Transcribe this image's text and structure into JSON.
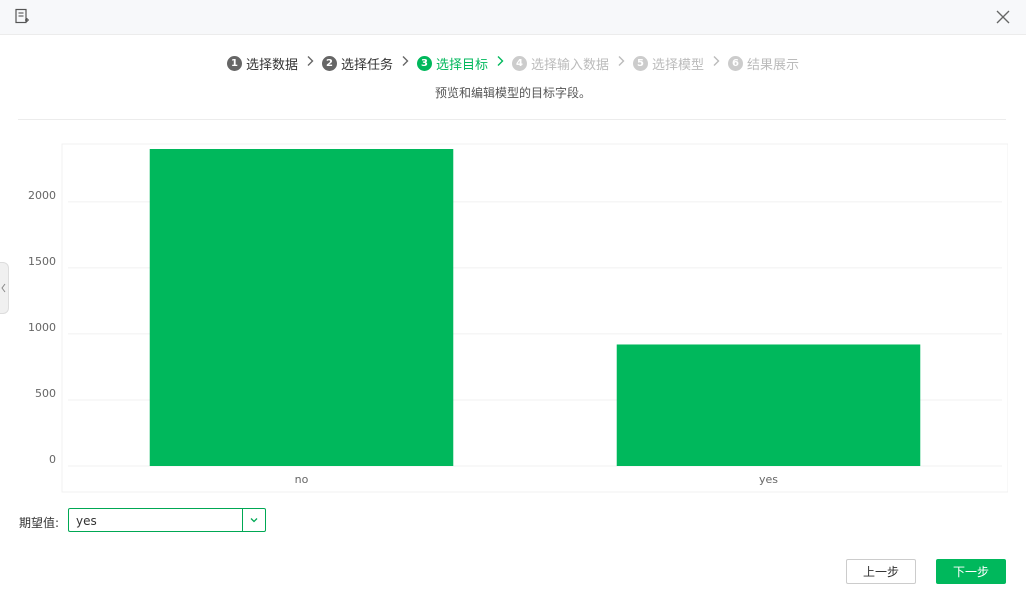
{
  "header": {
    "icons": [
      "document-edit-icon",
      "close-icon"
    ]
  },
  "steps": [
    {
      "num": "1",
      "label": "选择数据",
      "state": "done"
    },
    {
      "num": "2",
      "label": "选择任务",
      "state": "done"
    },
    {
      "num": "3",
      "label": "选择目标",
      "state": "active"
    },
    {
      "num": "4",
      "label": "选择输入数据",
      "state": "todo"
    },
    {
      "num": "5",
      "label": "选择模型",
      "state": "todo"
    },
    {
      "num": "6",
      "label": "结果展示",
      "state": "todo"
    }
  ],
  "subtitle": "预览和编辑模型的目标字段。",
  "chart_data": {
    "type": "bar",
    "categories": [
      "no",
      "yes"
    ],
    "values": [
      2400,
      920
    ],
    "title": "",
    "xlabel": "",
    "ylabel": "",
    "ylim": [
      0,
      2400
    ],
    "yticks": [
      0,
      500,
      1000,
      1500,
      2000
    ],
    "grid": true,
    "bar_color": "#00b85c"
  },
  "expected": {
    "label": "期望值:",
    "value": "yes"
  },
  "buttons": {
    "prev": "上一步",
    "next": "下一步"
  },
  "colors": {
    "accent": "#00b85c",
    "border_accent": "#00a854"
  }
}
